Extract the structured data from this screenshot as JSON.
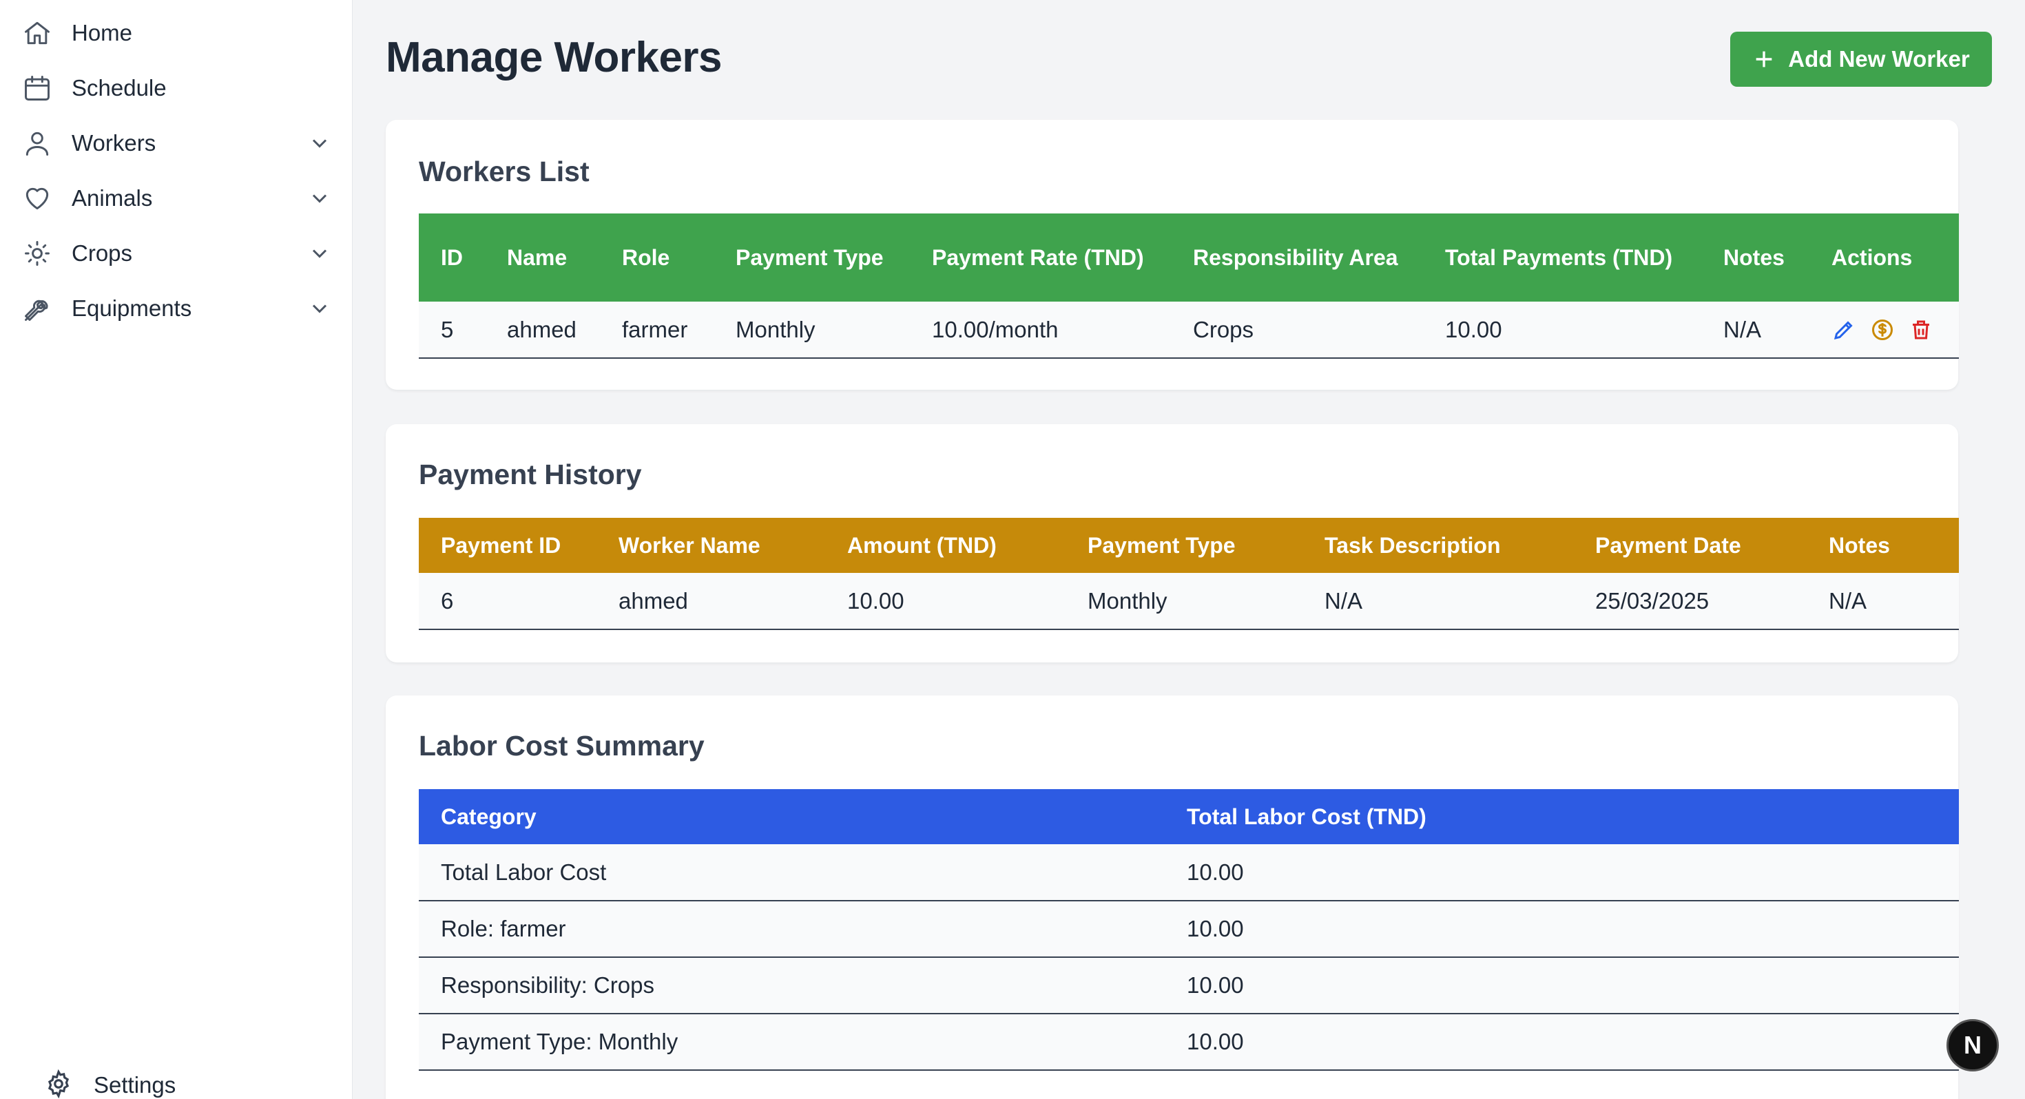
{
  "sidebar": {
    "items": [
      {
        "label": "Home",
        "icon": "home-icon"
      },
      {
        "label": "Schedule",
        "icon": "calendar-icon"
      },
      {
        "label": "Workers",
        "icon": "user-icon"
      },
      {
        "label": "Animals",
        "icon": "heart-icon"
      },
      {
        "label": "Crops",
        "icon": "sun-icon"
      },
      {
        "label": "Equipments",
        "icon": "wrench-icon"
      }
    ],
    "settings_label": "Settings"
  },
  "header": {
    "title": "Manage Workers",
    "add_button_label": "Add New Worker"
  },
  "workers_list": {
    "title": "Workers List",
    "columns": [
      "ID",
      "Name",
      "Role",
      "Payment Type",
      "Payment Rate (TND)",
      "Responsibility Area",
      "Total Payments (TND)",
      "Notes",
      "Actions"
    ],
    "rows": [
      {
        "id": "5",
        "name": "ahmed",
        "role": "farmer",
        "payment_type": "Monthly",
        "payment_rate": "10.00/month",
        "area": "Crops",
        "total": "10.00",
        "notes": "N/A"
      }
    ]
  },
  "payment_history": {
    "title": "Payment History",
    "columns": [
      "Payment ID",
      "Worker Name",
      "Amount (TND)",
      "Payment Type",
      "Task Description",
      "Payment Date",
      "Notes"
    ],
    "rows": [
      {
        "payment_id": "6",
        "worker_name": "ahmed",
        "amount": "10.00",
        "payment_type": "Monthly",
        "task": "N/A",
        "date": "25/03/2025",
        "notes": "N/A"
      }
    ]
  },
  "labor_summary": {
    "title": "Labor Cost Summary",
    "columns": [
      "Category",
      "Total Labor Cost (TND)"
    ],
    "rows": [
      {
        "category": "Total Labor Cost",
        "cost": "10.00"
      },
      {
        "category": "Role: farmer",
        "cost": "10.00"
      },
      {
        "category": "Responsibility: Crops",
        "cost": "10.00"
      },
      {
        "category": "Payment Type: Monthly",
        "cost": "10.00"
      }
    ]
  },
  "fab_label": "N",
  "colors": {
    "green": "#3fa34d",
    "gold": "#c68a0a",
    "blue": "#2d5be3"
  }
}
